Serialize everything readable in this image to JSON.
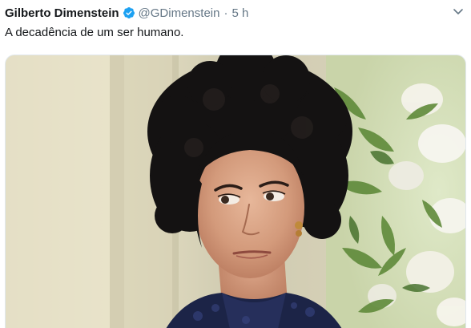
{
  "tweet": {
    "display_name": "Gilberto Dimenstein",
    "handle": "@GDimenstein",
    "separator": "·",
    "time": "5 h",
    "text": "A decadência de um ser humano.",
    "verified_icon": "verified-badge-icon",
    "menu_icon": "chevron-down-icon"
  },
  "media": {
    "image": "photo-woman-dark-voluminous-hair-side-glance"
  },
  "colors": {
    "text_primary": "#14171a",
    "text_secondary": "#657786",
    "verified_blue": "#1da1f2",
    "border": "#e1e8ed"
  }
}
